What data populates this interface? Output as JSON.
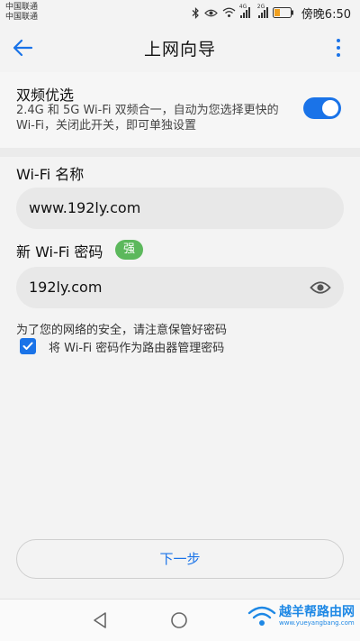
{
  "status_bar": {
    "carrier_1": "中国联通",
    "carrier_2": "中国联通",
    "net_1": "4G",
    "net_2": "2G",
    "time": "傍晚6:50"
  },
  "app_bar": {
    "title": "上网向导"
  },
  "dual_band": {
    "title": "双频优选",
    "description": "2.4G 和 5G Wi-Fi 双频合一，自动为您选择更快的 Wi-Fi，关闭此开关，即可单独设置",
    "enabled": true
  },
  "wifi_name": {
    "label": "Wi-Fi 名称",
    "value": "www.192ly.com"
  },
  "wifi_password": {
    "label": "新 Wi-Fi 密码",
    "strength": "强",
    "value": "192ly.com"
  },
  "security_note": "为了您的网络的安全，请注意保管好密码",
  "use_as_admin": {
    "checked": true,
    "label": "将 Wi-Fi 密码作为路由器管理密码"
  },
  "next_button": "下一步",
  "watermark": {
    "title": "越羊帮路由网",
    "url": "www.yueyangbang.com"
  },
  "colors": {
    "accent": "#1a73e8",
    "strength_badge": "#5cb85c"
  }
}
